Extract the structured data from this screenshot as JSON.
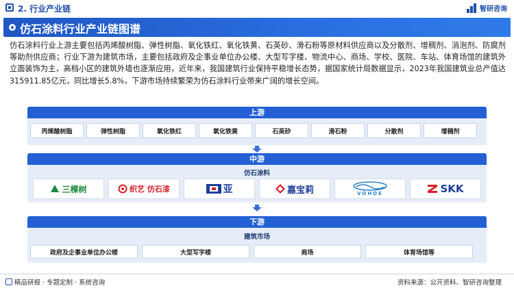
{
  "header": {
    "section_title": "2. 行业产业链",
    "brand": "智研咨询"
  },
  "title": "仿石涂料行业产业链图谱",
  "intro": "仿石涂料行业上游主要包括丙烯酸树脂、弹性树脂、氧化铁红、氧化铁黄、石英砂、滑石粉等原材料供应商以及分散剂、增稠剂、消泡剂、防腐剂等助剂供应商；行业下游为建筑市场，主要包括政府及企事业单位办公楼、大型写字楼、物流中心、商场、学校、医院、车站、体育场馆的建筑外立面装饰为主，高档小区的建筑外墙也逐渐应用，近年来，我国建筑行业保持平稳增长态势，据国家统计局数据显示，2023年我国建筑业总产值达315911.85亿元，同比增长5.8%，下游市场持续繁荣为仿石涂料行业带来广阔的增长空间。",
  "upstream": {
    "label": "上游",
    "items": [
      "丙烯酸树脂",
      "弹性树脂",
      "氧化铁红",
      "氧化铁黄",
      "石英砂",
      "滑石粉",
      "分散剂",
      "增稠剂"
    ]
  },
  "midstream": {
    "label": "中游",
    "sublabel": "仿石涂料",
    "logos": [
      {
        "text": "三棵树",
        "color": "#1b8a3a",
        "icon": "tree-logo-icon"
      },
      {
        "text": "织艺 仿石漆",
        "color": "#d4202a",
        "icon": "swirl-logo-icon"
      },
      {
        "text": "亚",
        "color": "#1d3f9a",
        "icon": "d-shield-logo-icon"
      },
      {
        "text": "嘉宝莉",
        "color": "#1d3f9a",
        "icon": "diamond-logo-icon"
      },
      {
        "text": "VOHOE",
        "color": "#2a7fc9",
        "icon": "wave-logo-icon"
      },
      {
        "text": "SKK",
        "color": "#1d3f9a",
        "icon": "z-logo-icon"
      }
    ]
  },
  "downstream": {
    "label": "下游",
    "sublabel": "建筑市场",
    "items": [
      "政府及企事业单位办公楼",
      "大型写字楼",
      "商场",
      "体育场馆等"
    ]
  },
  "footer": {
    "left": "精品研报 · 专题定制 · 系统咨询",
    "right": "资料来源：公开资料、智研咨询整理"
  }
}
